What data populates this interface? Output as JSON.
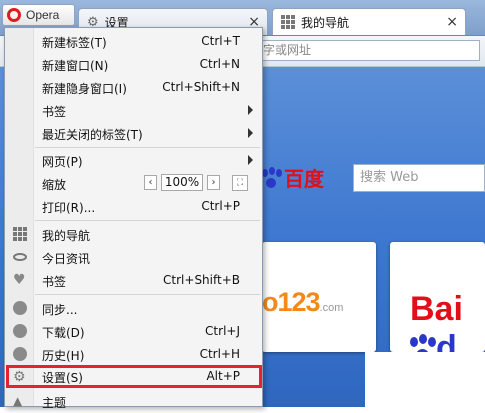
{
  "app": {
    "name": "Opera"
  },
  "tabs": [
    {
      "title": "设置",
      "close": "×"
    },
    {
      "title": "我的导航",
      "close": "×"
    }
  ],
  "address": {
    "placeholder": "字或网址"
  },
  "speed_dial": {
    "search_placeholder": "搜索 Web",
    "baidu_text": "百度",
    "tile1_logo": "o123",
    "tile1_domain": ".com",
    "tile2_logo_a": "Bai",
    "tile2_logo_b": "d"
  },
  "menu": {
    "items": [
      {
        "label": "新建标签(T)",
        "shortcut": "Ctrl+T"
      },
      {
        "label": "新建窗口(N)",
        "shortcut": "Ctrl+N"
      },
      {
        "label": "新建隐身窗口(I)",
        "shortcut": "Ctrl+Shift+N"
      },
      {
        "label": "书签",
        "shortcut": ""
      },
      {
        "label": "最近关闭的标签(T)",
        "shortcut": ""
      },
      {
        "label": "网页(P)",
        "shortcut": ""
      },
      {
        "label": "缩放",
        "shortcut": ""
      },
      {
        "label": "打印(R)...",
        "shortcut": "Ctrl+P"
      },
      {
        "label": "我的导航",
        "shortcut": ""
      },
      {
        "label": "今日资讯",
        "shortcut": ""
      },
      {
        "label": "书签",
        "shortcut": "Ctrl+Shift+B"
      },
      {
        "label": "同步...",
        "shortcut": ""
      },
      {
        "label": "下载(D)",
        "shortcut": "Ctrl+J"
      },
      {
        "label": "历史(H)",
        "shortcut": "Ctrl+H"
      },
      {
        "label": "设置(S)",
        "shortcut": "Alt+P"
      },
      {
        "label": "主题",
        "shortcut": ""
      }
    ],
    "zoom": {
      "minus": "‹",
      "value": "100%",
      "plus": "›",
      "fullscreen": "⛶"
    }
  }
}
